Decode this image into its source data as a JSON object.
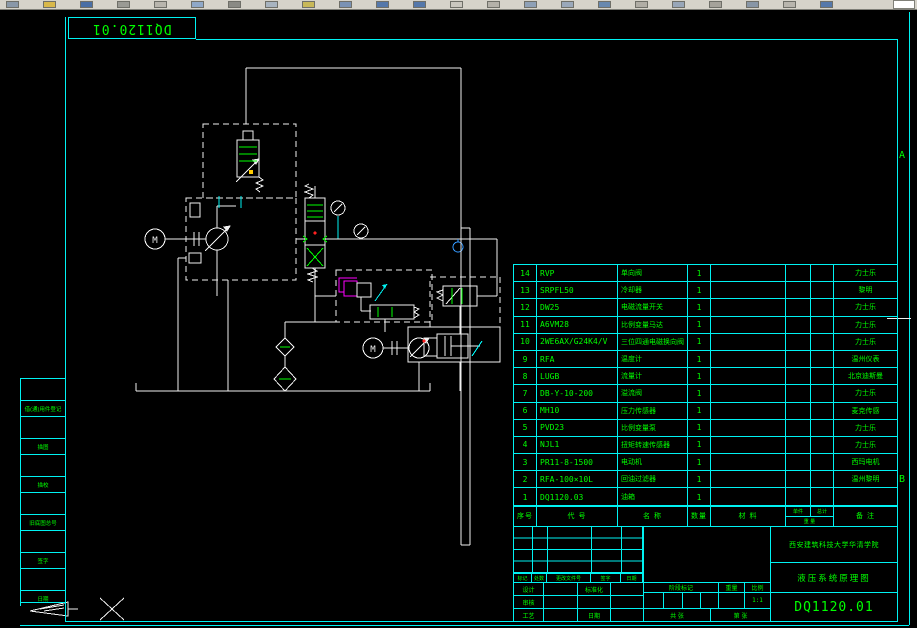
{
  "toolbar": {
    "icons": [
      {
        "name": "new-file-icon",
        "color": "#8a98a8"
      },
      {
        "name": "open-file-icon",
        "color": "#d8b84a"
      },
      {
        "name": "save-icon",
        "color": "#4a6fa5"
      },
      {
        "name": "plot-icon",
        "color": "#9a9a94"
      },
      {
        "name": "plot-preview-icon",
        "color": "#b8b5ad"
      },
      {
        "name": "publish-icon",
        "color": "#8fa8c8"
      },
      {
        "name": "cut-icon",
        "color": "#8a8a84"
      },
      {
        "name": "copy-icon",
        "color": "#a8b4c0"
      },
      {
        "name": "paste-icon",
        "color": "#c8b858"
      },
      {
        "name": "match-properties-icon",
        "color": "#7a92b4"
      },
      {
        "name": "undo-icon",
        "color": "#5578aa"
      },
      {
        "name": "redo-icon",
        "color": "#5578aa"
      },
      {
        "name": "pan-icon",
        "color": "#cac7bf"
      },
      {
        "name": "zoom-realtime-icon",
        "color": "#b4b1a9"
      },
      {
        "name": "zoom-window-icon",
        "color": "#8ea0b6"
      },
      {
        "name": "zoom-previous-icon",
        "color": "#9aa8ba"
      },
      {
        "name": "properties-icon",
        "color": "#6888ae"
      },
      {
        "name": "designcenter-icon",
        "color": "#b0ada5"
      },
      {
        "name": "tool-palettes-icon",
        "color": "#98a6b8"
      },
      {
        "name": "sheet-set-icon",
        "color": "#a5a29a"
      },
      {
        "name": "markup-icon",
        "color": "#8896a6"
      },
      {
        "name": "calculator-icon",
        "color": "#b8b5ad"
      },
      {
        "name": "help-icon",
        "color": "#5578aa"
      }
    ]
  },
  "sheet": {
    "corner_drawing_no": "DQ1120.01",
    "zone_labels": {
      "a": "A",
      "b": "B"
    }
  },
  "margin_strip": {
    "labels": [
      "借(通)用件登记",
      "描图",
      "描校",
      "旧底图总号",
      "签字",
      "日期"
    ]
  },
  "schematic": {
    "motor_label": "M"
  },
  "parts_table": {
    "headers": {
      "no": "序号",
      "code": "代 号",
      "name": "名 称",
      "qty": "数量",
      "material": "材 料",
      "weight_unit": "单件",
      "weight_total": "总计",
      "weight": "重 量",
      "remark": "备 注"
    },
    "rows": [
      {
        "no": "14",
        "code": "RVP",
        "name": "单向阀",
        "qty": "1",
        "remark": "力士乐"
      },
      {
        "no": "13",
        "code": "SRPFL50",
        "name": "冷却器",
        "qty": "1",
        "remark": "黎明"
      },
      {
        "no": "12",
        "code": "DW25",
        "name": "电磁流量开关",
        "qty": "1",
        "remark": "力士乐"
      },
      {
        "no": "11",
        "code": "A6VM28",
        "name": "比例变量马达",
        "qty": "1",
        "remark": "力士乐"
      },
      {
        "no": "10",
        "code": "2WE6AX/G24K4/V",
        "name": "三位四通电磁换向阀",
        "qty": "1",
        "remark": "力士乐"
      },
      {
        "no": "9",
        "code": "RFA",
        "name": "温度计",
        "qty": "1",
        "remark": "温州仪表"
      },
      {
        "no": "8",
        "code": "LUGB",
        "name": "流量计",
        "qty": "1",
        "remark": "北京迪斯曼"
      },
      {
        "no": "7",
        "code": "DB-Y-10-200",
        "name": "溢流阀",
        "qty": "1",
        "remark": "力士乐"
      },
      {
        "no": "6",
        "code": "MH10",
        "name": "压力传感器",
        "qty": "1",
        "remark": "麦克传感"
      },
      {
        "no": "5",
        "code": "PVD23",
        "name": "比例变量泵",
        "qty": "1",
        "remark": "力士乐"
      },
      {
        "no": "4",
        "code": "NJL1",
        "name": "扭矩转速传感器",
        "qty": "1",
        "remark": "力士乐"
      },
      {
        "no": "3",
        "code": "PR11-8-1500",
        "name": "电动机",
        "qty": "1",
        "remark": "西玛电机"
      },
      {
        "no": "2",
        "code": "RFA-100×10L",
        "name": "回油过滤器",
        "qty": "1",
        "remark": "温州黎明"
      },
      {
        "no": "1",
        "code": "DQ1120.03",
        "name": "油箱",
        "qty": "1",
        "remark": ""
      }
    ]
  },
  "title_block": {
    "company": "西安建筑科技大学华清学院",
    "drawing_title": "液压系统原理图",
    "drawing_no": "DQ1120.01",
    "scale": "1:1",
    "labels": {
      "mark": "标记",
      "count": "处数",
      "change_file": "更改文件号",
      "sign": "签字",
      "date": "日期",
      "design": "设计",
      "check": "审核",
      "process": "工艺",
      "standard": "标准化",
      "date2": "日期",
      "stage_mark": "阶段标记",
      "weight": "重量",
      "scale_label": "比例",
      "sheets_total": "共 张",
      "sheet_no": "第 张"
    }
  }
}
